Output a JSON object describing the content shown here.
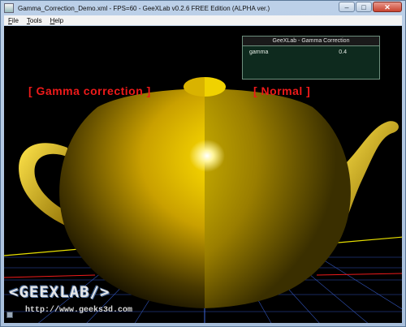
{
  "window": {
    "title": "Gamma_Correction_Demo.xml - FPS=60 - GeeXLab v0.2.6 FREE Edition (ALPHA ver.)",
    "minimize": "–",
    "maximize": "□",
    "close": "✕"
  },
  "menu": [
    {
      "label": "File",
      "accel": "F",
      "rest": "ile"
    },
    {
      "label": "Tools",
      "accel": "T",
      "rest": "ools"
    },
    {
      "label": "Help",
      "accel": "H",
      "rest": "elp"
    }
  ],
  "scene": {
    "left_label": "[ Gamma correction ]",
    "right_label": "[ Normal ]"
  },
  "panel": {
    "title": "GeeXLab - Gamma Correction",
    "param_name": "gamma",
    "param_value": "0.4"
  },
  "logo": {
    "text": "<GEEXLAB/>",
    "url": "http://www.geeks3d.com"
  },
  "colors": {
    "accent_red": "#ee1a1a",
    "teapot_gold": "#e8c400",
    "grid_blue": "#3b63d9"
  }
}
